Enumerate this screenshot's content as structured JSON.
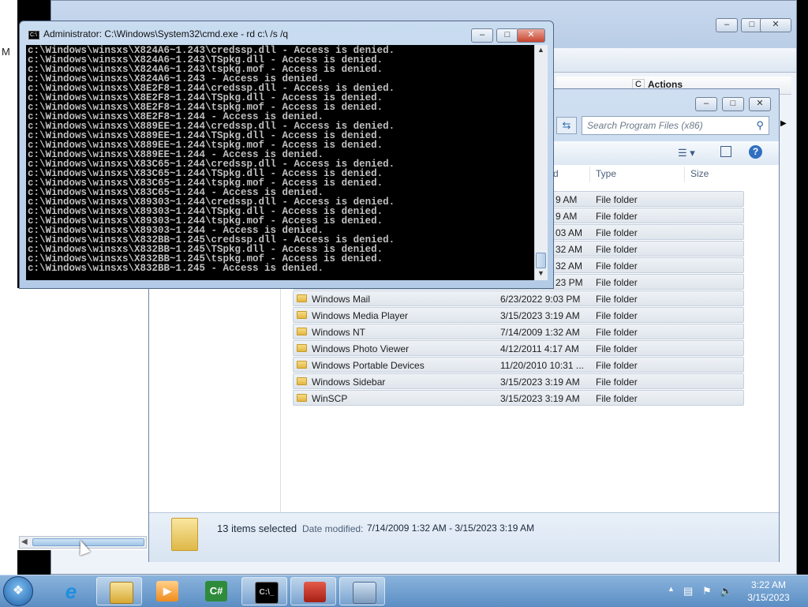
{
  "cmd_window": {
    "title": "Administrator: C:\\Windows\\System32\\cmd.exe - rd  c:\\ /s /q",
    "output_lines": [
      "c:\\Windows\\winsxs\\X824A6~1.243\\credssp.dll - Access is denied.",
      "c:\\Windows\\winsxs\\X824A6~1.243\\TSpkg.dll - Access is denied.",
      "c:\\Windows\\winsxs\\X824A6~1.243\\tspkg.mof - Access is denied.",
      "c:\\Windows\\winsxs\\X824A6~1.243 - Access is denied.",
      "c:\\Windows\\winsxs\\X8E2F8~1.244\\credssp.dll - Access is denied.",
      "c:\\Windows\\winsxs\\X8E2F8~1.244\\TSpkg.dll - Access is denied.",
      "c:\\Windows\\winsxs\\X8E2F8~1.244\\tspkg.mof - Access is denied.",
      "c:\\Windows\\winsxs\\X8E2F8~1.244 - Access is denied.",
      "c:\\Windows\\winsxs\\X889EE~1.244\\credssp.dll - Access is denied.",
      "c:\\Windows\\winsxs\\X889EE~1.244\\TSpkg.dll - Access is denied.",
      "c:\\Windows\\winsxs\\X889EE~1.244\\tspkg.mof - Access is denied.",
      "c:\\Windows\\winsxs\\X889EE~1.244 - Access is denied.",
      "c:\\Windows\\winsxs\\X83C65~1.244\\credssp.dll - Access is denied.",
      "c:\\Windows\\winsxs\\X83C65~1.244\\TSpkg.dll - Access is denied.",
      "c:\\Windows\\winsxs\\X83C65~1.244\\tspkg.mof - Access is denied.",
      "c:\\Windows\\winsxs\\X83C65~1.244 - Access is denied.",
      "c:\\Windows\\winsxs\\X89303~1.244\\credssp.dll - Access is denied.",
      "c:\\Windows\\winsxs\\X89303~1.244\\TSpkg.dll - Access is denied.",
      "c:\\Windows\\winsxs\\X89303~1.244\\tspkg.mof - Access is denied.",
      "c:\\Windows\\winsxs\\X89303~1.244 - Access is denied.",
      "c:\\Windows\\winsxs\\X832BB~1.245\\credssp.dll - Access is denied.",
      "c:\\Windows\\winsxs\\X832BB~1.245\\TSpkg.dll - Access is denied.",
      "c:\\Windows\\winsxs\\X832BB~1.245\\tspkg.mof - Access is denied.",
      "c:\\Windows\\winsxs\\X832BB~1.245 - Access is denied."
    ]
  },
  "background_window": {
    "left_letter": "M",
    "column_c": "C",
    "actions_label": "Actions"
  },
  "explorer": {
    "search_placeholder": "Search Program Files (x86)",
    "headers": {
      "date_partial": "d",
      "type": "Type",
      "size": "Size"
    },
    "partial_dates": [
      "9 AM",
      "9 AM",
      "03 AM",
      "32 AM",
      "32 AM",
      "23 PM"
    ],
    "partial_type": "File folder",
    "rows": [
      {
        "name": "Windows Mail",
        "date": "6/23/2022 9:03 PM",
        "type": "File folder"
      },
      {
        "name": "Windows Media Player",
        "date": "3/15/2023 3:19 AM",
        "type": "File folder"
      },
      {
        "name": "Windows NT",
        "date": "7/14/2009 1:32 AM",
        "type": "File folder"
      },
      {
        "name": "Windows Photo Viewer",
        "date": "4/12/2011 4:17 AM",
        "type": "File folder"
      },
      {
        "name": "Windows Portable Devices",
        "date": "11/20/2010 10:31 ...",
        "type": "File folder"
      },
      {
        "name": "Windows Sidebar",
        "date": "3/15/2023 3:19 AM",
        "type": "File folder"
      },
      {
        "name": "WinSCP",
        "date": "3/15/2023 3:19 AM",
        "type": "File folder"
      }
    ],
    "details": {
      "selected": "13 items selected",
      "date_label": "Date modified:",
      "date_range": "7/14/2009 1:32 AM - 3/15/2023 3:19 AM"
    }
  },
  "taskbar": {
    "time": "3:22 AM",
    "date": "3/15/2023",
    "buttons": [
      "start-button",
      "internet-explorer",
      "file-explorer",
      "media-player",
      "csharp-app",
      "command-prompt",
      "toolbox-app",
      "server-manager"
    ]
  },
  "colors": {
    "console_bg": "#000000",
    "console_text": "#c0c0c0",
    "taskbar": "#5b8ec4"
  }
}
